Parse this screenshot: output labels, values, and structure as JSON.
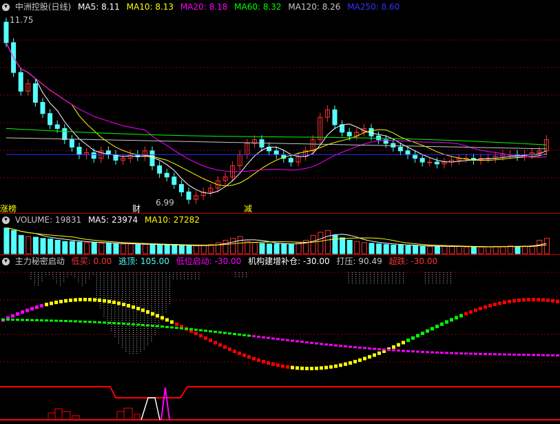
{
  "colors": {
    "bg": "#000000",
    "up": "#ff3232",
    "down": "#54ffff",
    "ma5": "#ffffff",
    "ma10": "#ffff00",
    "ma20": "#ff00ff",
    "ma60": "#00ff00",
    "ma120": "#c8c8c8",
    "ma250": "#3232ff",
    "grid": "#8b0000"
  },
  "price_panel": {
    "title": "中洲控股(日线)",
    "ma5": "MA5: 8.11",
    "ma10": "MA10: 8.13",
    "ma20": "MA20: 8.18",
    "ma60": "MA60: 8.32",
    "ma120": "MA120: 8.26",
    "ma250": "MA250: 8.60",
    "high_label": "11.75",
    "low_label": "6.99",
    "marker_left": "涨榜",
    "marker_cai": "财",
    "marker_jian": "减"
  },
  "volume_panel": {
    "title": "VOLUME: 19831",
    "ma5": "MA5: 23974",
    "ma10": "MA10: 27282"
  },
  "indicator_panel": {
    "title": "主力秘密启动",
    "low_buy": "低买: 0.00",
    "escape_top": "逃顶: 105.00",
    "low_start": "低位启动: -30.00",
    "inst_build": "机构建增补仓: -30.00",
    "press": "打压: 90.49",
    "oversold": "超跌: -30.00"
  },
  "chart_data": [
    {
      "type": "candlestick",
      "title": "中洲控股(日线)",
      "high": 11.75,
      "low": 6.99,
      "close": [
        11.2,
        10.4,
        9.9,
        10.1,
        9.6,
        9.3,
        9.0,
        8.9,
        8.6,
        8.4,
        8.2,
        8.25,
        8.1,
        8.3,
        8.2,
        8.05,
        8.1,
        8.2,
        8.15,
        8.3,
        7.9,
        7.7,
        7.6,
        7.4,
        7.2,
        7.0,
        7.1,
        7.2,
        7.3,
        7.5,
        7.6,
        7.9,
        8.2,
        8.5,
        8.6,
        8.4,
        8.3,
        8.2,
        8.1,
        8.0,
        8.15,
        8.3,
        8.6,
        9.2,
        9.4,
        9.0,
        8.8,
        8.7,
        8.8,
        8.9,
        8.7,
        8.6,
        8.5,
        8.4,
        8.3,
        8.2,
        8.1,
        8.0,
        8.0,
        7.95,
        8.0,
        8.05,
        8.1,
        8.1,
        8.05,
        8.1,
        8.1,
        8.15,
        8.2,
        8.2,
        8.15,
        8.2,
        8.25,
        8.3,
        8.6
      ],
      "ma_labels": [
        "MA5: 8.11",
        "MA10: 8.13",
        "MA20: 8.18",
        "MA60: 8.32",
        "MA120: 8.26",
        "MA250: 8.60"
      ]
    },
    {
      "type": "bar",
      "title": "VOLUME: 19831",
      "values": [
        42,
        38,
        30,
        28,
        27,
        25,
        24,
        22,
        20,
        20,
        19,
        18,
        18,
        17,
        17,
        16,
        16,
        16,
        15,
        15,
        15,
        14,
        14,
        14,
        13,
        13,
        13,
        14,
        15,
        18,
        22,
        25,
        28,
        20,
        18,
        17,
        16,
        16,
        16,
        15,
        18,
        22,
        30,
        35,
        38,
        30,
        26,
        22,
        20,
        18,
        17,
        16,
        15,
        14,
        14,
        13,
        13,
        12,
        12,
        12,
        12,
        12,
        12,
        11,
        11,
        11,
        11,
        12,
        12,
        13,
        12,
        12,
        13,
        22,
        25
      ]
    },
    {
      "type": "line",
      "title": "主力秘密启动",
      "series": [
        {
          "name": "逃顶",
          "values": [
            105
          ]
        },
        {
          "name": "打压",
          "values": [
            90.49
          ]
        },
        {
          "name": "低买",
          "values": [
            0.0
          ]
        },
        {
          "name": "低位启动",
          "values": [
            -30.0
          ]
        },
        {
          "name": "机构建增补仓",
          "values": [
            -30.0
          ]
        },
        {
          "name": "超跌",
          "values": [
            -30.0
          ]
        }
      ]
    }
  ]
}
